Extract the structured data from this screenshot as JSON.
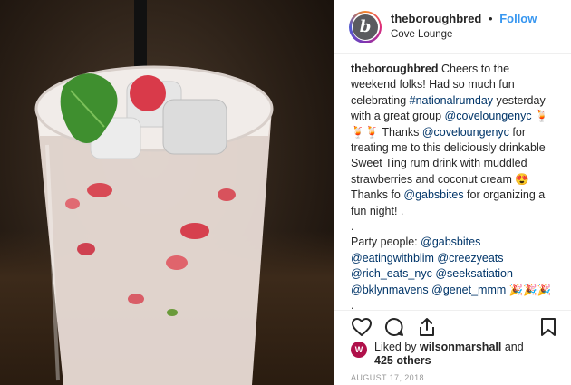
{
  "post": {
    "username": "theboroughbred",
    "separator": "•",
    "follow_label": "Follow",
    "location": "Cove Lounge",
    "avatar_letter": "b"
  },
  "caption": {
    "line1": "Cheers to the weekend folks! Had so much fun celebrating ",
    "hashtag": "#nationalrumday",
    "line2": " yesterday with a great group ",
    "mention1": "@coveloungenyc",
    "emoji1": " 🍹🍹🍹 ",
    "line3": " Thanks ",
    "mention2": "@coveloungenyc",
    "line4": " for treating me to this deliciously drinkable Sweet Ting rum drink with muddled strawberries and coconut cream ",
    "emoji2": "😍",
    "line5": " Thanks fo ",
    "mention3": "@gabsbites",
    "line6": " for organizing a fun night! .",
    "dot": ".",
    "party_label": "Party people: ",
    "people": [
      "@gabsbites",
      "@eatingwithblim",
      "@creezyeats",
      "@rich_eats_nyc",
      "@seeksatiation",
      "@bklynmavens",
      "@genet_mmm"
    ],
    "party_emoji": "🎉🎉🎉"
  },
  "likes": {
    "prefix": "Liked by ",
    "user": "wilsonmarshall",
    "and": " and",
    "others": "425 others",
    "avatar_letter": "W"
  },
  "date": "AUGUST 17, 2018",
  "icons": [
    "heart-icon",
    "comment-icon",
    "share-icon",
    "bookmark-icon"
  ]
}
